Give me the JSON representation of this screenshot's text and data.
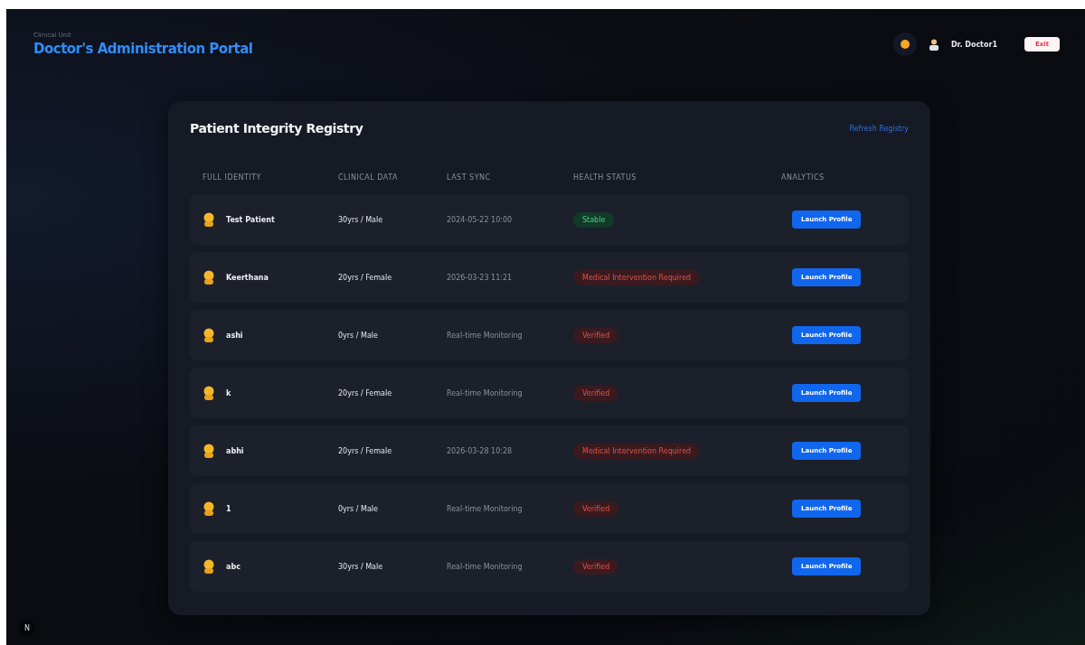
{
  "header": {
    "subtitle": "Clinical Unit",
    "title": "Doctor's Administration Portal",
    "user": "Dr. Doctor1",
    "logout": "Exit"
  },
  "registry": {
    "title": "Patient Integrity Registry",
    "link": "Refresh Registry",
    "columns": [
      "FULL IDENTITY",
      "CLINICAL DATA",
      "LAST SYNC",
      "HEALTH STATUS",
      "ANALYTICS"
    ],
    "rows": [
      {
        "name": "Test Patient",
        "clinical": "30yrs / Male",
        "sync": "2024-05-22 10:00",
        "status": "Stable",
        "kind": "stable",
        "action": "Launch Profile"
      },
      {
        "name": "Keerthana",
        "clinical": "20yrs / Female",
        "sync": "2026-03-23 11:21",
        "status": "Medical Intervention Required",
        "kind": "alert",
        "action": "Launch Profile"
      },
      {
        "name": "ashi",
        "clinical": "0yrs / Male",
        "sync": "Real-time Monitoring",
        "status": "Verified",
        "kind": "alert",
        "action": "Launch Profile"
      },
      {
        "name": "k",
        "clinical": "20yrs / Female",
        "sync": "Real-time Monitoring",
        "status": "Verified",
        "kind": "alert",
        "action": "Launch Profile"
      },
      {
        "name": "abhi",
        "clinical": "20yrs / Female",
        "sync": "2026-03-28 10:28",
        "status": "Medical Intervention Required",
        "kind": "alert",
        "action": "Launch Profile"
      },
      {
        "name": "1",
        "clinical": "0yrs / Male",
        "sync": "Real-time Monitoring",
        "status": "Verified",
        "kind": "alert",
        "action": "Launch Profile"
      },
      {
        "name": "abc",
        "clinical": "30yrs / Male",
        "sync": "Real-time Monitoring",
        "status": "Verified",
        "kind": "alert",
        "action": "Launch Profile"
      }
    ]
  },
  "badge": "N"
}
